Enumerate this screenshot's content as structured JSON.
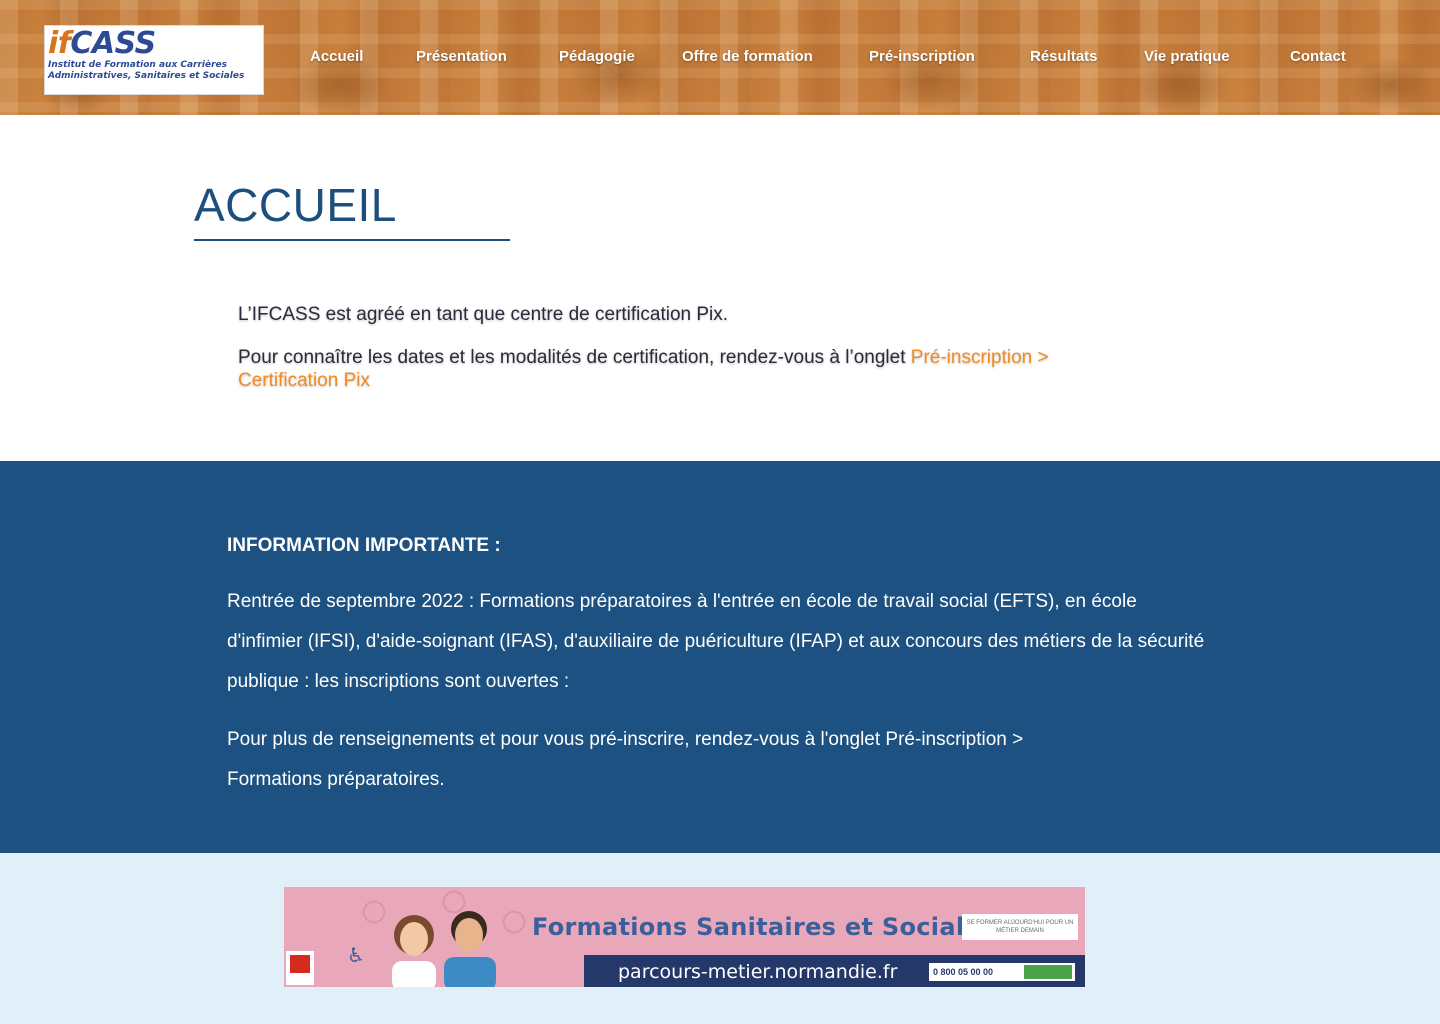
{
  "header": {
    "logo": {
      "mark_if": "if",
      "mark_cass": "CASS",
      "sub_line1": "Institut de Formation aux Carrières",
      "sub_line2": "Administratives, Sanitaires et Sociales"
    },
    "nav": [
      {
        "label": "Accueil"
      },
      {
        "label": "Présentation"
      },
      {
        "label": "Pédagogie"
      },
      {
        "label": "Offre de formation"
      },
      {
        "label": "Pré-inscription"
      },
      {
        "label": "Résultats"
      },
      {
        "label": "Vie pratique"
      },
      {
        "label": "Contact"
      }
    ]
  },
  "main": {
    "title": "ACCUEIL",
    "intro_line1": "L’IFCASS est agréé en tant que centre de certification Pix.",
    "intro_line2_text": "Pour connaître les dates et les modalités de certification, rendez-vous à l’onglet ",
    "intro_line2_link": "Pré-inscription > Certification Pix"
  },
  "info": {
    "title": "INFORMATION IMPORTANTE :",
    "body": "Rentrée de septembre 2022 : Formations préparatoires à l'entrée en école de travail social (EFTS), en école d'infimier (IFSI), d'aide-soignant (IFAS), d'auxiliaire de puériculture (IFAP) et aux concours des métiers de la sécurité publique : les inscriptions sont ouvertes :",
    "cta": " Pour plus de renseignements et pour vous pré-inscrire, rendez-vous à l'onglet Pré-inscription > Formations préparatoires."
  },
  "banner": {
    "title": "Formations Sanitaires et  Sociales",
    "url": "parcours-metier.normandie.fr",
    "tagline": "SE FORMER AUJOURD'HUI POUR UN MÉTIER DEMAIN",
    "phone": "0 800 05 00 00"
  },
  "colors": {
    "title_blue": "#1c4f7d",
    "info_band": "#1c5181",
    "footer_band": "#e1f0f8",
    "link_orange": "#f58a1f"
  }
}
